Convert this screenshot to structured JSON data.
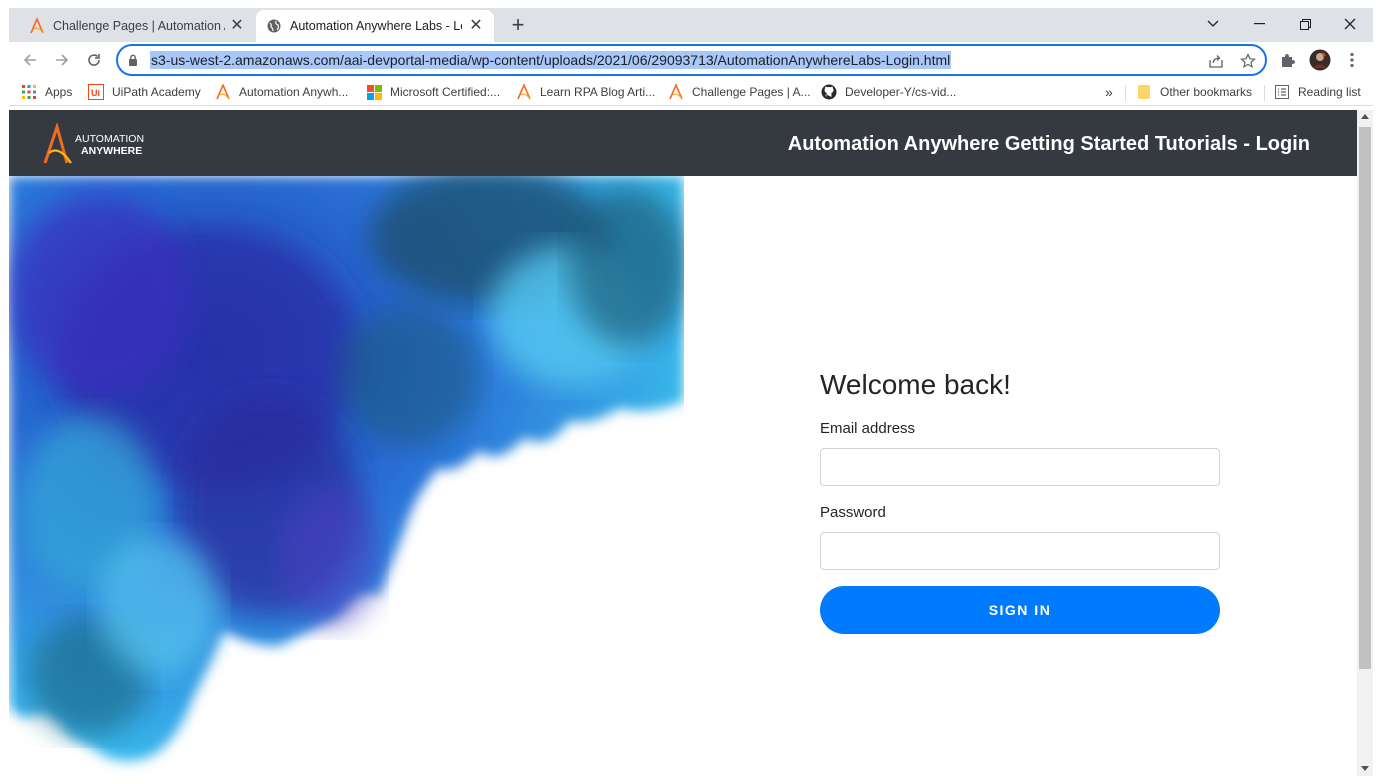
{
  "browser": {
    "tabs": [
      {
        "title": "Challenge Pages | Automation Anywhere",
        "icon": "automation-anywhere-icon",
        "active": false
      },
      {
        "title": "Automation Anywhere Labs - Login",
        "icon": "globe-icon",
        "active": true
      }
    ],
    "url": "s3-us-west-2.amazonaws.com/aai-devportal-media/wp-content/uploads/2021/06/29093713/AutomationAnywhereLabs-Login.html",
    "bookmarks": [
      {
        "label": "Apps",
        "icon": "apps-grid-icon"
      },
      {
        "label": "UiPath Academy",
        "icon": "uipath-icon"
      },
      {
        "label": "Automation Anywh...",
        "icon": "automation-anywhere-icon"
      },
      {
        "label": "Microsoft Certified:...",
        "icon": "microsoft-icon"
      },
      {
        "label": "Learn RPA Blog Arti...",
        "icon": "automation-anywhere-icon"
      },
      {
        "label": "Challenge Pages | A...",
        "icon": "automation-anywhere-icon"
      },
      {
        "label": "Developer-Y/cs-vid...",
        "icon": "github-icon"
      }
    ],
    "overflow_label": "»",
    "other_bookmarks": "Other bookmarks",
    "reading_list": "Reading list"
  },
  "page": {
    "logo_line1": "AUTOMATION",
    "logo_line2": "ANYWHERE",
    "header_title": "Automation Anywhere Getting Started Tutorials - Login",
    "welcome": "Welcome back!",
    "email_label": "Email address",
    "email_value": "",
    "password_label": "Password",
    "password_value": "",
    "signin_label": "SIGN IN"
  },
  "colors": {
    "header_bg": "#343a40",
    "button_bg": "#007bff",
    "omnibox_focus": "#1a73e8"
  }
}
